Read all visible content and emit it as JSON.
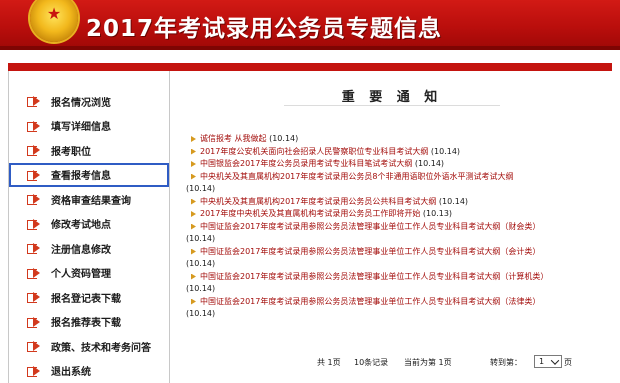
{
  "banner": {
    "title": "2017年考试录用公务员专题信息",
    "emblem_icon": "national-emblem-icon",
    "colors": {
      "banner_red": "#c4140f",
      "emblem_gold": "#f2b81c"
    }
  },
  "sidebar": {
    "items": [
      {
        "label": "报名情况浏览",
        "icon": "arrow-right-icon"
      },
      {
        "label": "填写详细信息",
        "icon": "arrow-right-icon"
      },
      {
        "label": "报考职位",
        "icon": "arrow-right-icon"
      },
      {
        "label": "查看报考信息",
        "icon": "arrow-right-icon",
        "selected": true
      },
      {
        "label": "资格审查结果查询",
        "icon": "arrow-right-icon"
      },
      {
        "label": "修改考试地点",
        "icon": "arrow-right-icon"
      },
      {
        "label": "注册信息修改",
        "icon": "arrow-right-icon"
      },
      {
        "label": "个人资码管理",
        "icon": "arrow-right-icon"
      },
      {
        "label": "报名登记表下载",
        "icon": "arrow-right-icon"
      },
      {
        "label": "报名推荐表下载",
        "icon": "arrow-right-icon"
      },
      {
        "label": "政策、技术和考务问答",
        "icon": "arrow-right-icon"
      },
      {
        "label": "退出系统",
        "icon": "arrow-right-icon"
      }
    ],
    "selected_outline_color": "#2f5cc4"
  },
  "main": {
    "title": "重 要 通 知",
    "news": [
      {
        "text": "诚信报考  从我做起",
        "date": "(10.14)"
      },
      {
        "text": "2017年度公安机关面向社会招录人民警察职位专业科目考试大纲",
        "date": "(10.14)"
      },
      {
        "text": "中国银监会2017年度公务员录用考试专业科目笔试考试大纲",
        "date": "(10.14)"
      },
      {
        "text": "中央机关及其直属机构2017年度考试录用公务员8个非通用语职位外语水平测试考试大纲",
        "date": "(10.14)"
      },
      {
        "text": "中央机关及其直属机构2017年度考试录用公务员公共科目考试大纲",
        "date": "(10.14)"
      },
      {
        "text": "2017年度中央机关及其直属机构考试录用公务员工作即将开始",
        "date": "(10.13)"
      },
      {
        "text": "中国证监会2017年度考试录用参照公务员法管理事业单位工作人员专业科目考试大纲（财会类）",
        "date": "(10.14)"
      },
      {
        "text": "中国证监会2017年度考试录用参照公务员法管理事业单位工作人员专业科目考试大纲（会计类）",
        "date": "(10.14)"
      },
      {
        "text": "中国证监会2017年度考试录用参照公务员法管理事业单位工作人员专业科目考试大纲（计算机类）",
        "date": "(10.14)"
      },
      {
        "text": "中国证监会2017年度考试录用参照公务员法管理事业单位工作人员专业科目考试大纲（法律类）",
        "date": "(10.14)"
      }
    ],
    "pager": {
      "total_pages": "共 1页",
      "total_records": "10条记录",
      "current": "当前为第 1页",
      "goto_label": "转到第：",
      "goto_value": "1",
      "goto_suffix": "页"
    }
  }
}
